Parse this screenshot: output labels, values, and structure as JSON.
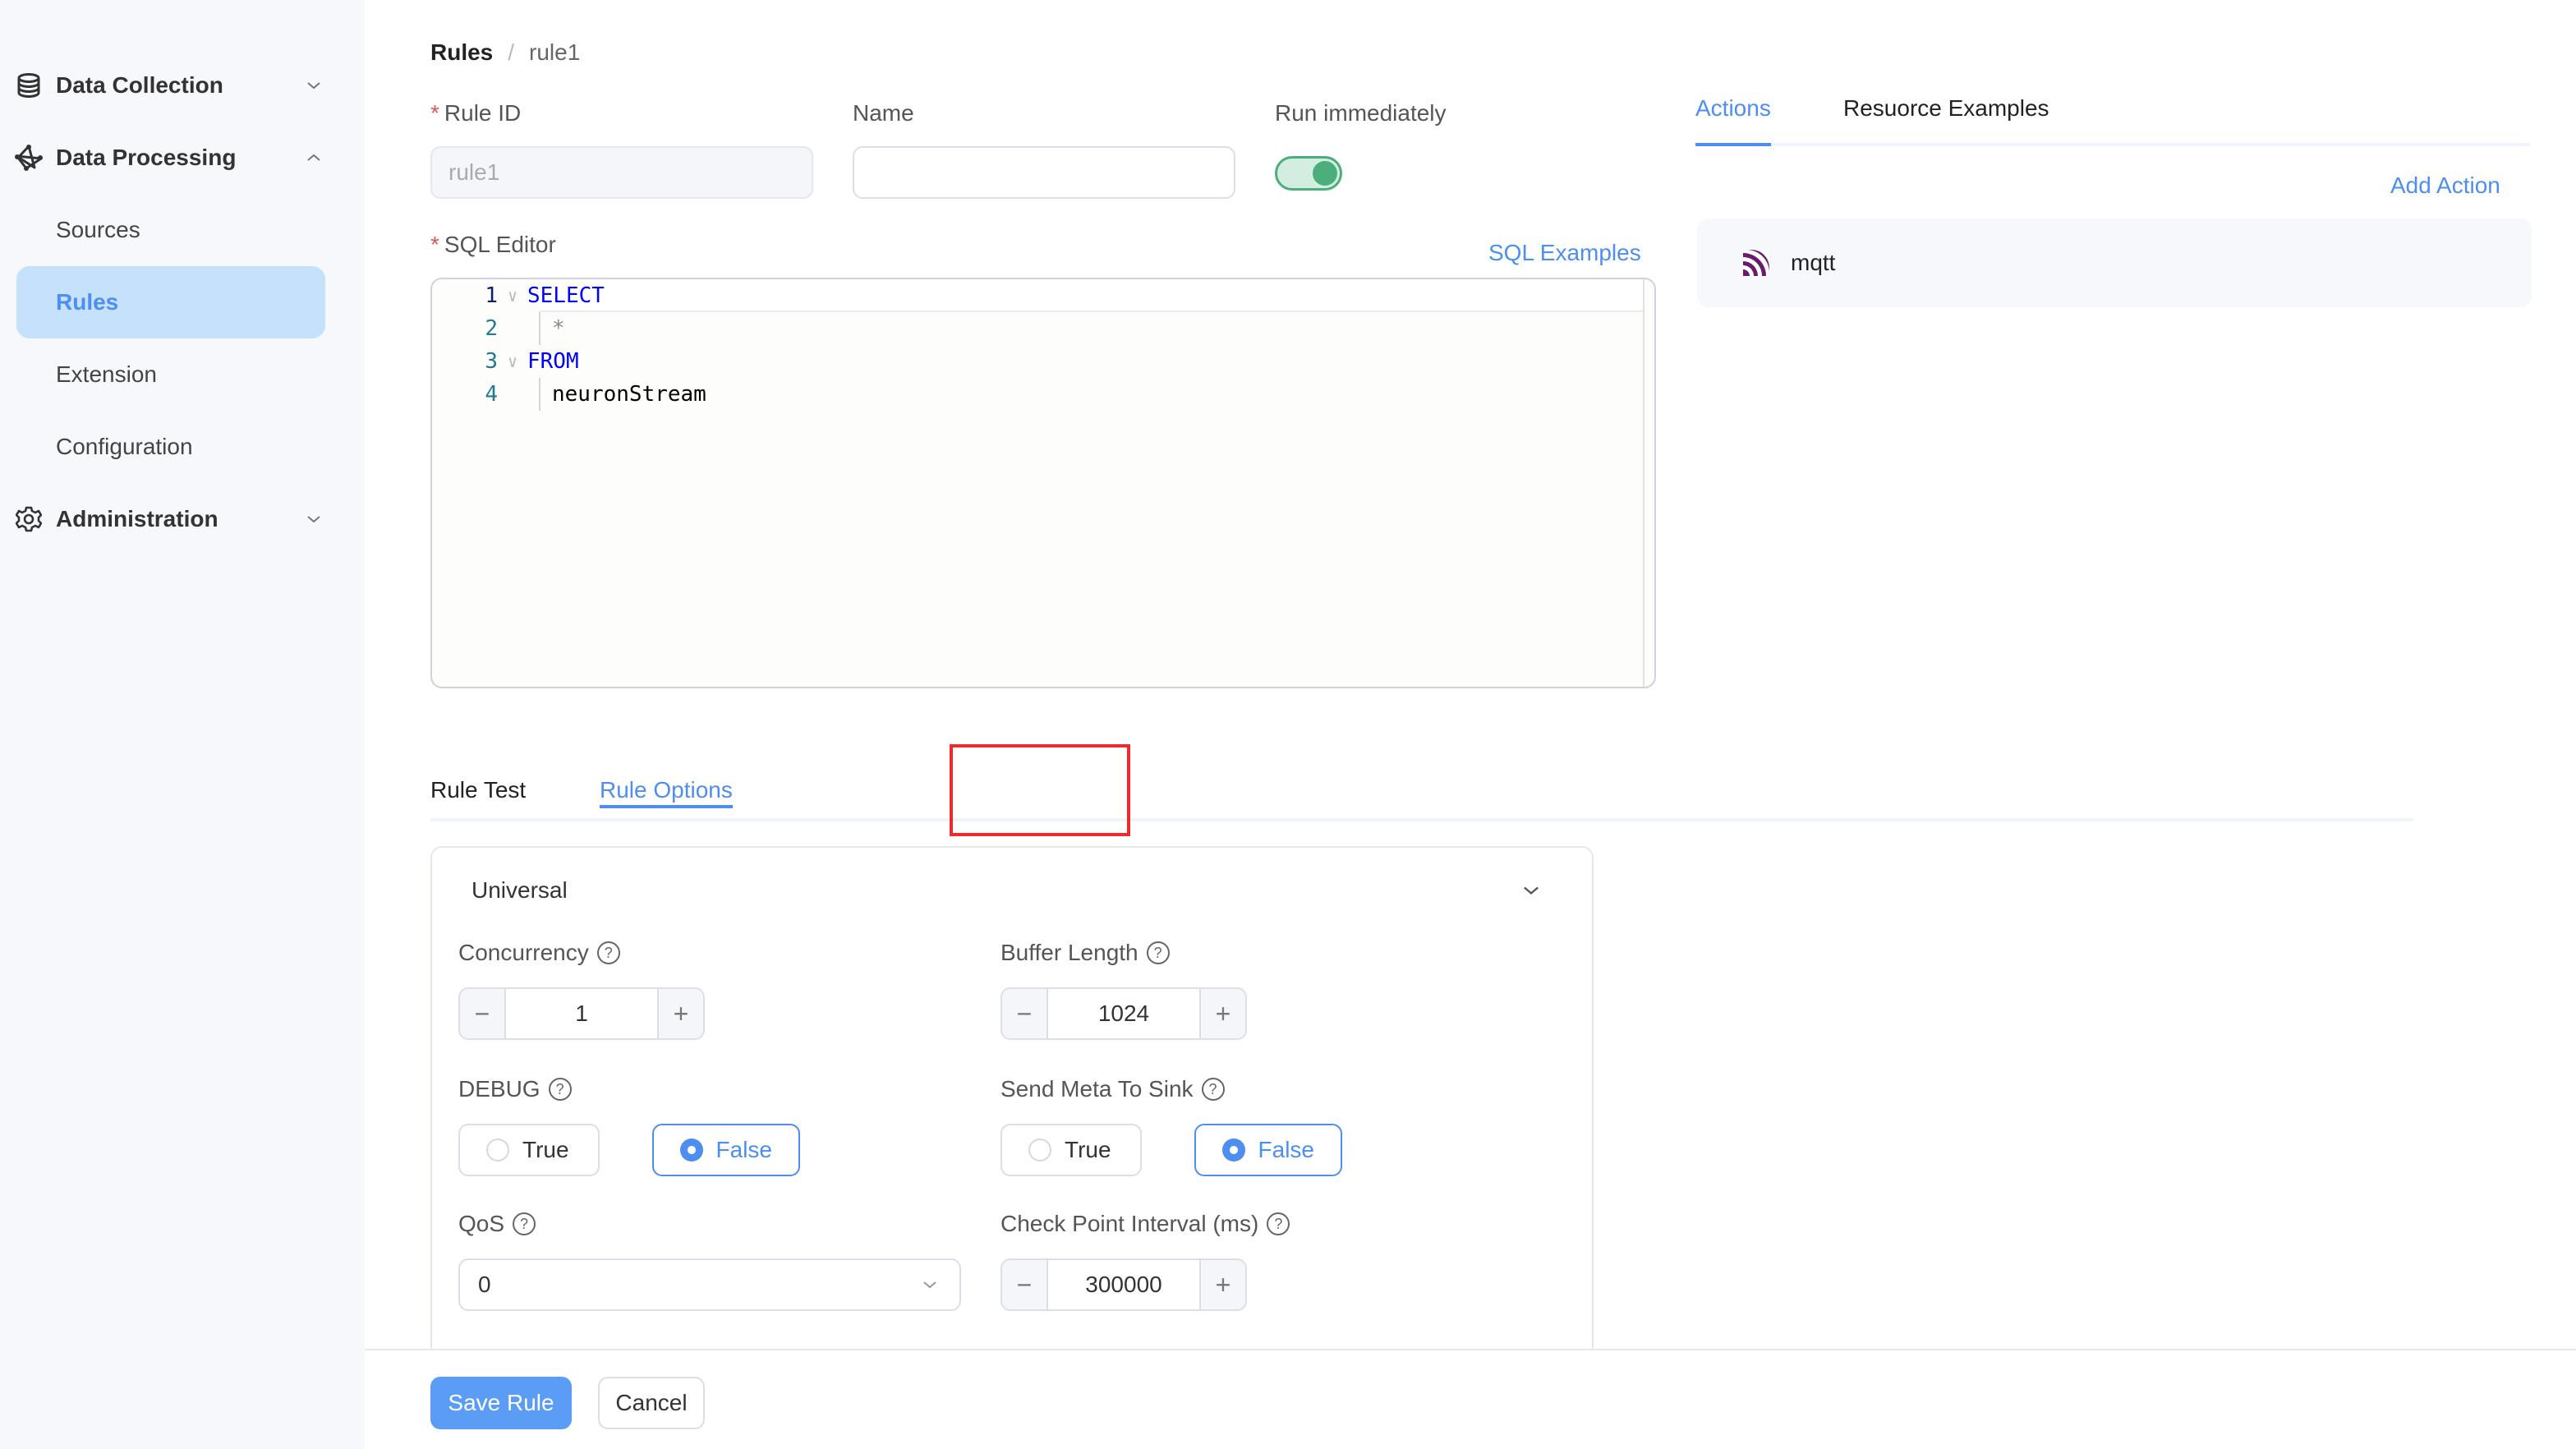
{
  "sidebar": {
    "groups": [
      {
        "label": "Data Collection",
        "icon": "database-icon",
        "expanded": false
      },
      {
        "label": "Data Processing",
        "icon": "network-icon",
        "expanded": true
      },
      {
        "label": "Administration",
        "icon": "gear-icon",
        "expanded": false
      }
    ],
    "sub_items": [
      {
        "label": "Sources",
        "active": false
      },
      {
        "label": "Rules",
        "active": true
      },
      {
        "label": "Extension",
        "active": false
      },
      {
        "label": "Configuration",
        "active": false
      }
    ]
  },
  "breadcrumb": {
    "root": "Rules",
    "separator": "/",
    "current": "rule1"
  },
  "form": {
    "rule_id": {
      "label": "Rule ID",
      "required": true,
      "value": "rule1",
      "disabled": true
    },
    "name": {
      "label": "Name",
      "value": "",
      "placeholder": ""
    },
    "run_immediately": {
      "label": "Run immediately",
      "on": true
    },
    "sql_editor": {
      "label": "SQL Editor",
      "required": true,
      "examples_link": "SQL Examples"
    }
  },
  "editor": {
    "lines": [
      {
        "num": "1",
        "text": "SELECT",
        "kind": "keyword",
        "foldable": true
      },
      {
        "num": "2",
        "text": "*",
        "kind": "operator",
        "foldable": false
      },
      {
        "num": "3",
        "text": "FROM",
        "kind": "keyword",
        "foldable": true
      },
      {
        "num": "4",
        "text": "neuronStream",
        "kind": "identifier",
        "foldable": false
      }
    ]
  },
  "right_panel": {
    "tabs": [
      {
        "label": "Actions",
        "active": true
      },
      {
        "label": "Resuorce Examples",
        "active": false
      }
    ],
    "add_action": "Add Action",
    "actions": [
      {
        "name": "mqtt",
        "icon": "mqtt-icon"
      }
    ]
  },
  "bottom_tabs": [
    {
      "label": "Rule Test",
      "active": false
    },
    {
      "label": "Rule Options",
      "active": true
    }
  ],
  "options": {
    "section_title": "Universal",
    "concurrency": {
      "label": "Concurrency",
      "value": "1"
    },
    "buffer_length": {
      "label": "Buffer Length",
      "value": "1024"
    },
    "debug": {
      "label": "DEBUG",
      "options": [
        "True",
        "False"
      ],
      "selected": "False"
    },
    "send_meta": {
      "label": "Send Meta To Sink",
      "options": [
        "True",
        "False"
      ],
      "selected": "False"
    },
    "qos": {
      "label": "QoS",
      "value": "0"
    },
    "checkpoint": {
      "label": "Check Point Interval (ms)",
      "value": "300000"
    },
    "help_glyph": "?",
    "minus_glyph": "−",
    "plus_glyph": "+"
  },
  "footer": {
    "save": "Save Rule",
    "cancel": "Cancel"
  },
  "colors": {
    "accent": "#4d8ef0",
    "toggle_on": "#4caf7b",
    "required": "#e05555",
    "highlight": "#ee2a2a",
    "sidebar_active_bg": "#c5e1fb"
  }
}
